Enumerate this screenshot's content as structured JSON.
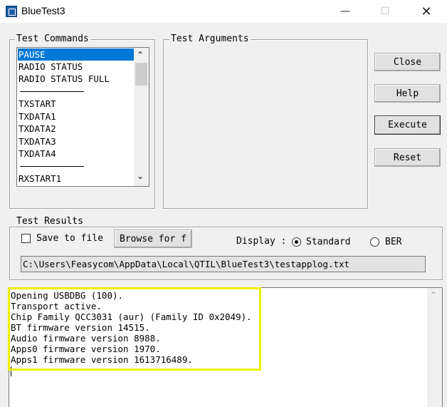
{
  "window": {
    "title": "BlueTest3",
    "min_label": "—",
    "max_label": "☐",
    "close_label": "✕"
  },
  "test_commands": {
    "label": "Test Commands",
    "items": [
      "PAUSE",
      "RADIO STATUS",
      "RADIO STATUS FULL",
      "TXSTART",
      "TXDATA1",
      "TXDATA2",
      "TXDATA3",
      "TXDATA4",
      "RXSTART1"
    ],
    "selected": "PAUSE",
    "scroll_up": "⌃",
    "scroll_down": "⌄"
  },
  "test_arguments": {
    "label": "Test Arguments"
  },
  "buttons": {
    "close": "Close",
    "help": "Help",
    "execute": "Execute",
    "reset": "Reset"
  },
  "test_results": {
    "label": "Test Results",
    "save_to_file": "Save to file",
    "browse": "Browse for f",
    "display_label": "Display :",
    "radio_standard": "Standard",
    "radio_ber": "BER",
    "selected_display": "Standard",
    "log_path": "C:\\Users\\Feasycom\\AppData\\Local\\QTIL\\BlueTest3\\testapplog.txt"
  },
  "output": {
    "lines": [
      "Opening USBDBG (100).",
      "Transport active.",
      "Chip Family QCC3031 (aur) (Family ID 0x2049).",
      "BT firmware version 14515.",
      "Audio firmware version 8988.",
      "Apps0 firmware version 1970.",
      "Apps1 firmware version 1613716489."
    ],
    "scroll_up": "⌃"
  },
  "colors": {
    "selection": "#0078d7",
    "highlight": "#f2ef00",
    "app_icon": "#1f5fa8"
  },
  "icons": [
    "app-icon",
    "minimize-icon",
    "maximize-icon",
    "close-icon"
  ]
}
